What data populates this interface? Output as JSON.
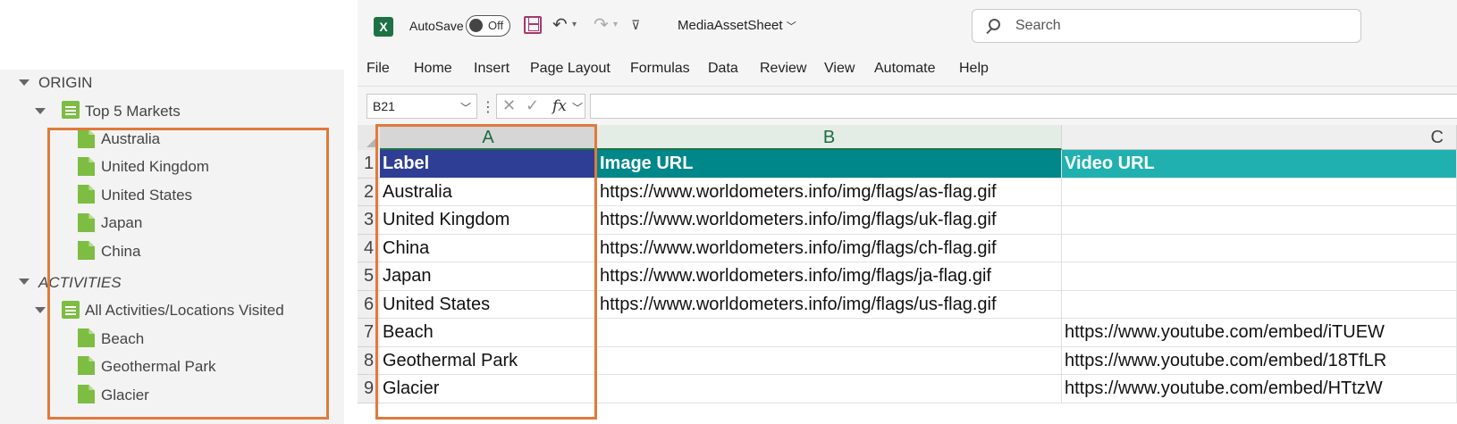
{
  "tree": {
    "section_origin": "ORIGIN",
    "origin_group": "Top 5 Markets",
    "origin_items": [
      "Australia",
      "United Kingdom",
      "United States",
      "Japan",
      "China"
    ],
    "section_activities": "ACTIVITIES",
    "activities_group": "All Activities/Locations Visited",
    "activities_items": [
      "Beach",
      "Geothermal Park",
      "Glacier"
    ]
  },
  "excel": {
    "autosave_label": "AutoSave",
    "autosave_state": "Off",
    "document_name": "MediaAssetSheet",
    "search_placeholder": "Search",
    "ribbon_tabs": [
      "File",
      "Home",
      "Insert",
      "Page Layout",
      "Formulas",
      "Data",
      "Review",
      "View",
      "Automate",
      "Help"
    ],
    "name_box": "B21",
    "formula": "",
    "columns": [
      "A",
      "B",
      "C"
    ],
    "rows": [
      {
        "num": "1",
        "a": "Label",
        "b": "Image URL",
        "c": "Video URL"
      },
      {
        "num": "2",
        "a": "Australia",
        "b": "https://www.worldometers.info/img/flags/as-flag.gif",
        "c": ""
      },
      {
        "num": "3",
        "a": "United Kingdom",
        "b": "https://www.worldometers.info/img/flags/uk-flag.gif",
        "c": ""
      },
      {
        "num": "4",
        "a": "China",
        "b": "https://www.worldometers.info/img/flags/ch-flag.gif",
        "c": ""
      },
      {
        "num": "5",
        "a": "Japan",
        "b": "https://www.worldometers.info/img/flags/ja-flag.gif",
        "c": ""
      },
      {
        "num": "6",
        "a": "United States",
        "b": "https://www.worldometers.info/img/flags/us-flag.gif",
        "c": ""
      },
      {
        "num": "7",
        "a": "Beach",
        "b": "",
        "c": "https://www.youtube.com/embed/iTUEW"
      },
      {
        "num": "8",
        "a": "Geothermal Park",
        "b": "",
        "c": "https://www.youtube.com/embed/18TfLR"
      },
      {
        "num": "9",
        "a": "Glacier",
        "b": "",
        "c": "https://www.youtube.com/embed/HTtzW"
      }
    ]
  },
  "colors": {
    "header_a": "#2e3e94",
    "header_b": "#00878a",
    "header_c": "#21b0b0",
    "highlight": "#e07a3c",
    "excel_green": "#217346"
  }
}
